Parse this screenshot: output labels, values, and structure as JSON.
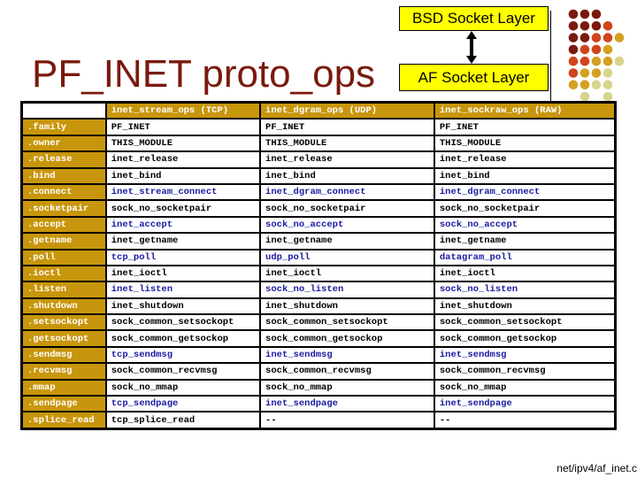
{
  "title": "PF_INET proto_ops",
  "diagram": {
    "top_box": "BSD Socket Layer",
    "bottom_box": "AF Socket Layer",
    "arrow": "double-headed-vertical-arrow",
    "box_color": "#ffff00"
  },
  "decoration": {
    "dot_colors": {
      "dark": "#7a1a0c",
      "orange": "#d0451b",
      "gold": "#d4a020",
      "pale": "#d6d58c"
    },
    "dot_rows": [
      [
        "dark",
        "dark",
        "dark",
        null,
        null
      ],
      [
        "dark",
        "dark",
        "dark",
        "orange",
        null
      ],
      [
        "dark",
        "dark",
        "orange",
        "orange",
        "gold"
      ],
      [
        "dark",
        "orange",
        "orange",
        "gold",
        null
      ],
      [
        "orange",
        "orange",
        "gold",
        "gold",
        "pale"
      ],
      [
        "orange",
        "gold",
        "gold",
        "pale",
        null
      ],
      [
        "gold",
        "gold",
        "pale",
        "pale",
        null
      ],
      [
        null,
        "pale",
        null,
        "pale",
        null
      ]
    ]
  },
  "table": {
    "header_color": "#c8960c",
    "highlight_color": "#1a1aa0",
    "columns": [
      "",
      "inet_stream_ops (TCP)",
      "inet_dgram_ops (UDP)",
      "inet_sockraw_ops (RAW)"
    ],
    "rows": [
      {
        "key": ".family",
        "tcp": "PF_INET",
        "udp": "PF_INET",
        "raw": "PF_INET",
        "highlight": false
      },
      {
        "key": ".owner",
        "tcp": "THIS_MODULE",
        "udp": "THIS_MODULE",
        "raw": "THIS_MODULE",
        "highlight": false
      },
      {
        "key": ".release",
        "tcp": "inet_release",
        "udp": "inet_release",
        "raw": "inet_release",
        "highlight": false
      },
      {
        "key": ".bind",
        "tcp": "inet_bind",
        "udp": "inet_bind",
        "raw": "inet_bind",
        "highlight": false
      },
      {
        "key": ".connect",
        "tcp": "inet_stream_connect",
        "udp": "inet_dgram_connect",
        "raw": "inet_dgram_connect",
        "highlight": true
      },
      {
        "key": ".socketpair",
        "tcp": "sock_no_socketpair",
        "udp": "sock_no_socketpair",
        "raw": "sock_no_socketpair",
        "highlight": false
      },
      {
        "key": ".accept",
        "tcp": "inet_accept",
        "udp": "sock_no_accept",
        "raw": "sock_no_accept",
        "highlight": true
      },
      {
        "key": ".getname",
        "tcp": "inet_getname",
        "udp": "inet_getname",
        "raw": "inet_getname",
        "highlight": false
      },
      {
        "key": ".poll",
        "tcp": "tcp_poll",
        "udp": "udp_poll",
        "raw": "datagram_poll",
        "highlight": true
      },
      {
        "key": ".ioctl",
        "tcp": "inet_ioctl",
        "udp": "inet_ioctl",
        "raw": "inet_ioctl",
        "highlight": false
      },
      {
        "key": ".listen",
        "tcp": "inet_listen",
        "udp": "sock_no_listen",
        "raw": "sock_no_listen",
        "highlight": true
      },
      {
        "key": ".shutdown",
        "tcp": "inet_shutdown",
        "udp": "inet_shutdown",
        "raw": "inet_shutdown",
        "highlight": false
      },
      {
        "key": ".setsockopt",
        "tcp": "sock_common_setsockopt",
        "udp": "sock_common_setsockopt",
        "raw": "sock_common_setsockopt",
        "highlight": false
      },
      {
        "key": ".getsockopt",
        "tcp": "sock_common_getsockop",
        "udp": "sock_common_getsockop",
        "raw": "sock_common_getsockop",
        "highlight": false
      },
      {
        "key": ".sendmsg",
        "tcp": "tcp_sendmsg",
        "udp": "inet_sendmsg",
        "raw": "inet_sendmsg",
        "highlight": true
      },
      {
        "key": ".recvmsg",
        "tcp": "sock_common_recvmsg",
        "udp": "sock_common_recvmsg",
        "raw": "sock_common_recvmsg",
        "highlight": false
      },
      {
        "key": ".mmap",
        "tcp": "sock_no_mmap",
        "udp": "sock_no_mmap",
        "raw": "sock_no_mmap",
        "highlight": false
      },
      {
        "key": ".sendpage",
        "tcp": "tcp_sendpage",
        "udp": "inet_sendpage",
        "raw": "inet_sendpage",
        "highlight": true
      },
      {
        "key": ".splice_read",
        "tcp": "tcp_splice_read",
        "udp": "--",
        "raw": "--",
        "highlight": false
      }
    ]
  },
  "source_file": "net/ipv4/af_inet.c"
}
